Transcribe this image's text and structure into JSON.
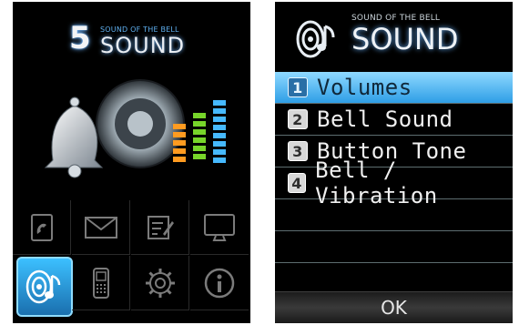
{
  "left": {
    "number": "5",
    "subtitle": "SOUND OF THE BELL",
    "title": "SOUND",
    "icons": [
      {
        "name": "phonebook-icon",
        "selected": false
      },
      {
        "name": "message-icon",
        "selected": false
      },
      {
        "name": "notes-icon",
        "selected": false
      },
      {
        "name": "display-icon",
        "selected": false
      },
      {
        "name": "sound-icon",
        "selected": true
      },
      {
        "name": "phone-icon",
        "selected": false
      },
      {
        "name": "settings-icon",
        "selected": false
      },
      {
        "name": "info-icon",
        "selected": false
      }
    ]
  },
  "right": {
    "subtitle": "SOUND OF THE BELL",
    "title": "SOUND",
    "menu": [
      {
        "num": "1",
        "label": "Volumes",
        "selected": true
      },
      {
        "num": "2",
        "label": "Bell Sound",
        "selected": false
      },
      {
        "num": "3",
        "label": "Button Tone",
        "selected": false
      },
      {
        "num": "4",
        "label": "Bell / Vibration",
        "selected": false
      }
    ],
    "softkey": "OK"
  },
  "colors": {
    "accent": "#3cc0ff",
    "glow": "#6fb6ff",
    "menu_selected": "#2e9ee6"
  }
}
